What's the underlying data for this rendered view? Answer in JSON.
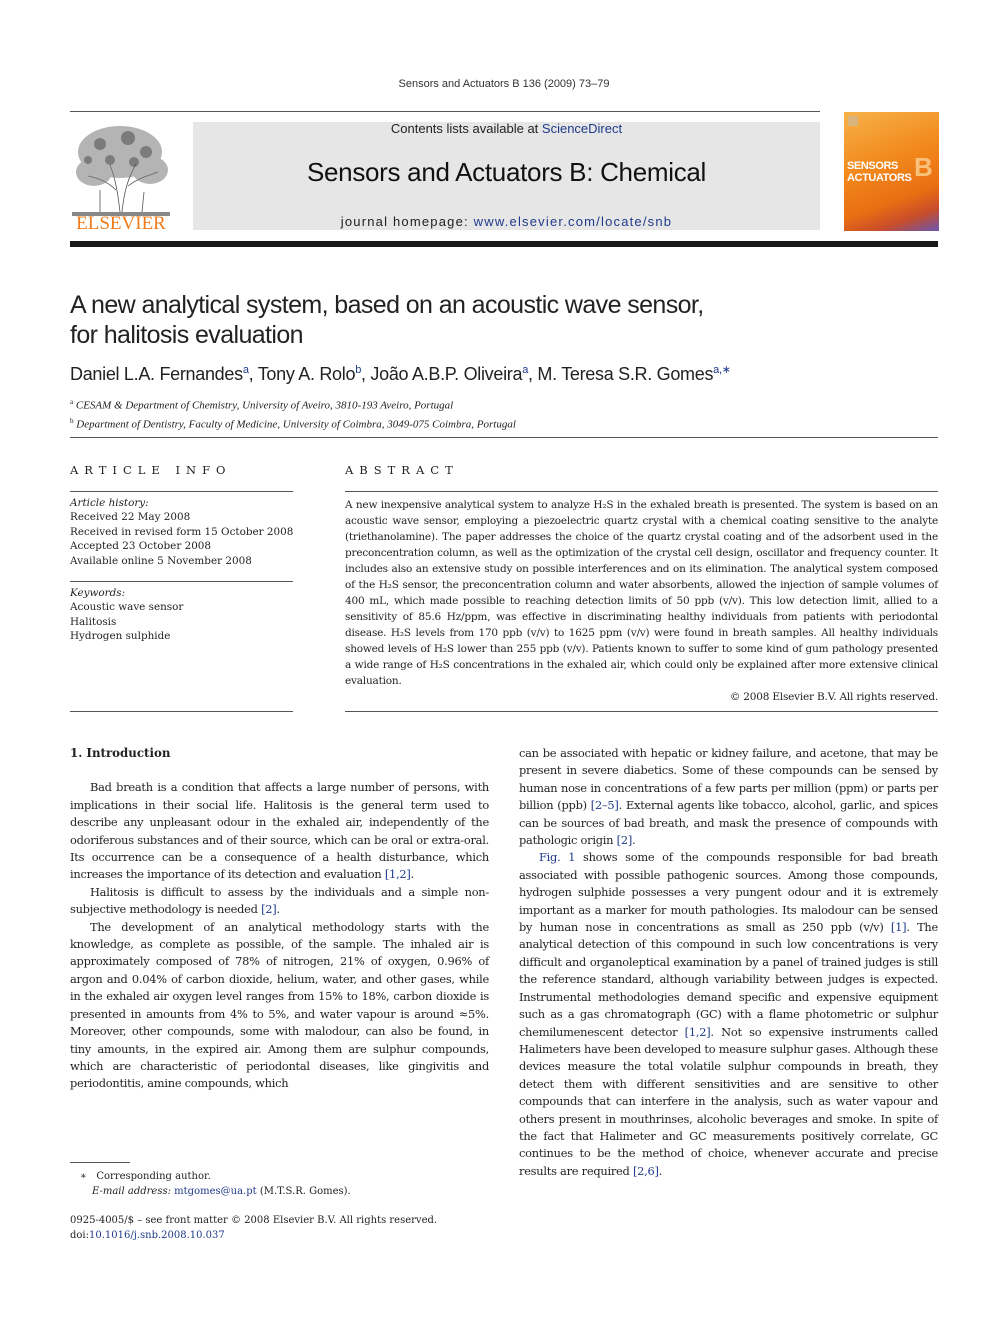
{
  "running_head": "Sensors and Actuators B 136 (2009) 73–79",
  "masthead": {
    "publisher_wordmark": "ELSEVIER",
    "contents_prefix": "Contents lists available at ",
    "contents_link": "ScienceDirect",
    "journal_title": "Sensors and Actuators B: Chemical",
    "homepage_prefix": "journal homepage: ",
    "homepage_link": "www.elsevier.com/locate/snb",
    "cover": {
      "title_line1": "SENSORS",
      "title_line2": "ACTUATORS",
      "series_letter": "B"
    }
  },
  "article": {
    "title": "A new analytical system, based on an acoustic wave sensor, for halitosis evaluation",
    "authors": [
      {
        "name": "Daniel L.A. Fernandes",
        "marks": "a"
      },
      {
        "name": "Tony A. Rolo",
        "marks": "b"
      },
      {
        "name": "João A.B.P. Oliveira",
        "marks": "a"
      },
      {
        "name": "M. Teresa S.R. Gomes",
        "marks": "a,∗"
      }
    ],
    "affiliations": [
      {
        "mark": "a",
        "text": "CESAM & Department of Chemistry, University of Aveiro, 3810-193 Aveiro, Portugal"
      },
      {
        "mark": "b",
        "text": "Department of Dentistry, Faculty of Medicine, University of Coimbra, 3049-075 Coimbra, Portugal"
      }
    ]
  },
  "article_info": {
    "heading": "ARTICLE INFO",
    "history_label": "Article history:",
    "history": [
      "Received 22 May 2008",
      "Received in revised form 15 October 2008",
      "Accepted 23 October 2008",
      "Available online 5 November 2008"
    ],
    "keywords_label": "Keywords:",
    "keywords": [
      "Acoustic wave sensor",
      "Halitosis",
      "Hydrogen sulphide"
    ]
  },
  "abstract": {
    "heading": "ABSTRACT",
    "text": "A new inexpensive analytical system to analyze H₂S in the exhaled breath is presented. The system is based on an acoustic wave sensor, employing a piezoelectric quartz crystal with a chemical coating sensitive to the analyte (triethanolamine). The paper addresses the choice of the quartz crystal coating and of the adsorbent used in the preconcentration column, as well as the optimization of the crystal cell design, oscillator and frequency counter. It includes also an extensive study on possible interferences and on its elimination. The analytical system composed of the H₂S sensor, the preconcentration column and water absorbents, allowed the injection of sample volumes of 400 mL, which made possible to reaching detection limits of 50 ppb (v/v). This low detection limit, allied to a sensitivity of 85.6 Hz/ppm, was effective in discriminating healthy individuals from patients with periodontal disease. H₂S levels from 170 ppb (v/v) to 1625 ppm (v/v) were found in breath samples. All healthy individuals showed levels of H₂S lower than 255 ppb (v/v). Patients known to suffer to some kind of gum pathology presented a wide range of H₂S concentrations in the exhaled air, which could only be explained after more extensive clinical evaluation.",
    "copyright": "© 2008 Elsevier B.V. All rights reserved."
  },
  "body": {
    "section_heading": "1.  Introduction",
    "left_paragraphs": [
      {
        "text": "Bad breath is a condition that affects a large number of persons, with implications in their social life. Halitosis is the general term used to describe any unpleasant odour in the exhaled air, independently of the odoriferous substances and of their source, which can be oral or extra-oral. Its occurrence can be a consequence of a health disturbance, which increases the importance of its detection and evaluation ",
        "ref": "[1,2]",
        "tail": "."
      },
      {
        "text": "Halitosis is difficult to assess by the individuals and a simple non-subjective methodology is needed ",
        "ref": "[2]",
        "tail": "."
      },
      {
        "text": "The development of an analytical methodology starts with the knowledge, as complete as possible, of the sample. The inhaled air is approximately composed of 78% of nitrogen, 21% of oxygen, 0.96% of argon and 0.04% of carbon dioxide, helium, water, and other gases, while in the exhaled air oxygen level ranges from 15% to 18%, carbon dioxide is presented in amounts from 4% to 5%, and water vapour is around ≈5%. Moreover, other compounds, some with malodour, can also be found, in tiny amounts, in the expired air. Among them are sulphur compounds, which are characteristic of periodontal diseases, like gingivitis and periodontitis, amine compounds, which",
        "ref": "",
        "tail": ""
      }
    ],
    "right_continuation": {
      "parts": [
        "can be associated with hepatic or kidney failure, and acetone, that may be present in severe diabetics. Some of these compounds can be sensed by human nose in concentrations of a few parts per million (ppm) or parts per billion (ppb) ",
        "[2–5]",
        ". External agents like tobacco, alcohol, garlic, and spices can be sources of bad breath, and mask the presence of compounds with pathologic origin ",
        "[2]",
        "."
      ]
    },
    "right_paragraph_2": {
      "fig_ref": "Fig. 1",
      "parts": [
        " shows some of the compounds responsible for bad breath associated with possible pathogenic sources. Among those compounds, hydrogen sulphide possesses a very pungent odour and it is extremely important as a marker for mouth pathologies. Its malodour can be sensed by human nose in concentrations as small as 250 ppb (v/v) ",
        "[1]",
        ". The analytical detection of this compound in such low concentrations is very difficult and organoleptical examination by a panel of trained judges is still the reference standard, although variability between judges is expected. Instrumental methodologies demand specific and expensive equipment such as a gas chromatograph (GC) with a flame photometric or sulphur chemilumenescent detector ",
        "[1,2]",
        ". Not so expensive instruments called Halimeters have been developed to measure sulphur gases. Although these devices measure the total volatile sulphur compounds in breath, they detect them with different sensitivities and are sensitive to other compounds that can interfere in the analysis, such as water vapour and others present in mouthrinses, alcoholic beverages and smoke. In spite of the fact that Halimeter and GC measurements positively correlate, GC continues to be the method of choice, whenever accurate and precise results are required ",
        "[2,6]",
        "."
      ]
    }
  },
  "footnotes": {
    "corresponding_mark": "∗",
    "corresponding_text": "Corresponding author.",
    "email_label": "E-mail address: ",
    "email": "mtgomes@ua.pt",
    "email_owner": " (M.T.S.R. Gomes).",
    "front_matter": "0925-4005/$ – see front matter © 2008 Elsevier B.V. All rights reserved.",
    "doi_label": "doi:",
    "doi": "10.1016/j.snb.2008.10.037"
  }
}
